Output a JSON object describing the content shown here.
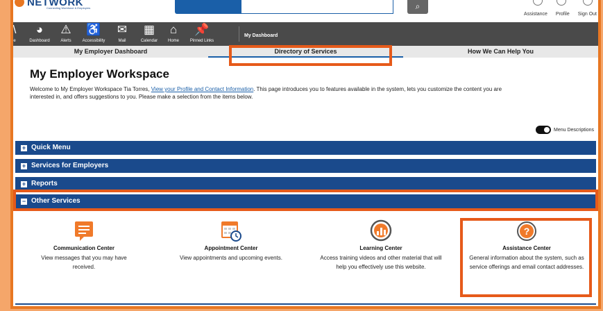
{
  "header": {
    "logo_text": "NETWORK",
    "logo_tagline": "Connecting Workforce & Employers",
    "search_placeholder": "",
    "links": [
      "Assistance",
      "Profile",
      "Sign Out"
    ]
  },
  "nav": {
    "items": [
      {
        "label": "e",
        "icon": "home-icon"
      },
      {
        "label": "Dashboard",
        "icon": "dashboard-icon"
      },
      {
        "label": "Alerts",
        "icon": "alert-icon"
      },
      {
        "label": "Accessibility",
        "icon": "accessibility-icon"
      },
      {
        "label": "Mail",
        "icon": "mail-icon"
      },
      {
        "label": "Calendar",
        "icon": "calendar-icon"
      },
      {
        "label": "Home",
        "icon": "home-icon"
      },
      {
        "label": "Pinned Links",
        "icon": "pin-icon"
      }
    ],
    "dashboard_label": "My Dashboard"
  },
  "tabs": [
    "My Employer Dashboard",
    "Directory of Services",
    "How We Can Help You"
  ],
  "page": {
    "title": "My Employer Workspace",
    "intro_before_link": "Welcome to My Employer Workspace Tia Torres, ",
    "intro_link": "View your Profile and Contact Information",
    "intro_after_link": ". This page introduces you to features available in the system, lets you customize the content you are interested in, and offers suggestions to you. Please make a selection from the items below.",
    "toggle_label": "Menu Descriptions"
  },
  "sections": [
    {
      "label": "Quick Menu",
      "state": "+"
    },
    {
      "label": "Services for Employers",
      "state": "+"
    },
    {
      "label": "Reports",
      "state": "+"
    },
    {
      "label": "Other Services",
      "state": "−"
    }
  ],
  "cards": [
    {
      "title": "Communication Center",
      "desc": "View messages that you may have received."
    },
    {
      "title": "Appointment Center",
      "desc": "View appointments and upcoming events."
    },
    {
      "title": "Learning Center",
      "desc": "Access training videos and other material that will help you effectively use this website."
    },
    {
      "title": "Assistance Center",
      "desc": "General information about the system, such as service offerings and email contact addresses."
    }
  ],
  "colors": {
    "accent_orange": "#e65a1a",
    "section_blue": "#1a4a8c",
    "nav_gray": "#4a4a4a"
  }
}
